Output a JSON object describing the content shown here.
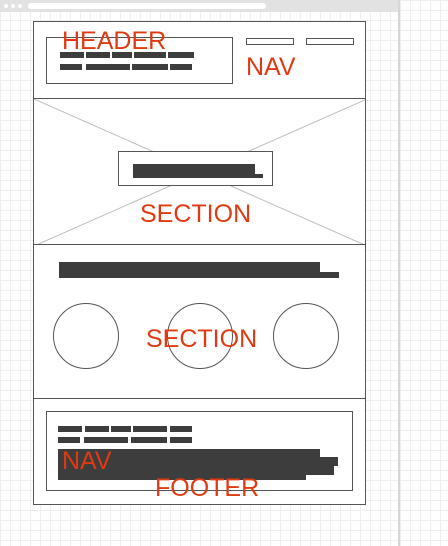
{
  "labels": {
    "header": "HEADER",
    "header_nav": "NAV",
    "hero_section": "SECTION",
    "feature_section": "SECTION",
    "footer_nav": "NAV",
    "footer": "FOOTER"
  },
  "colors": {
    "annotation": "#e03a12",
    "outline": "#555555",
    "text_block": "#3d3d3d",
    "grid": "#efefef",
    "browser_chrome": "#e2e2e2"
  }
}
